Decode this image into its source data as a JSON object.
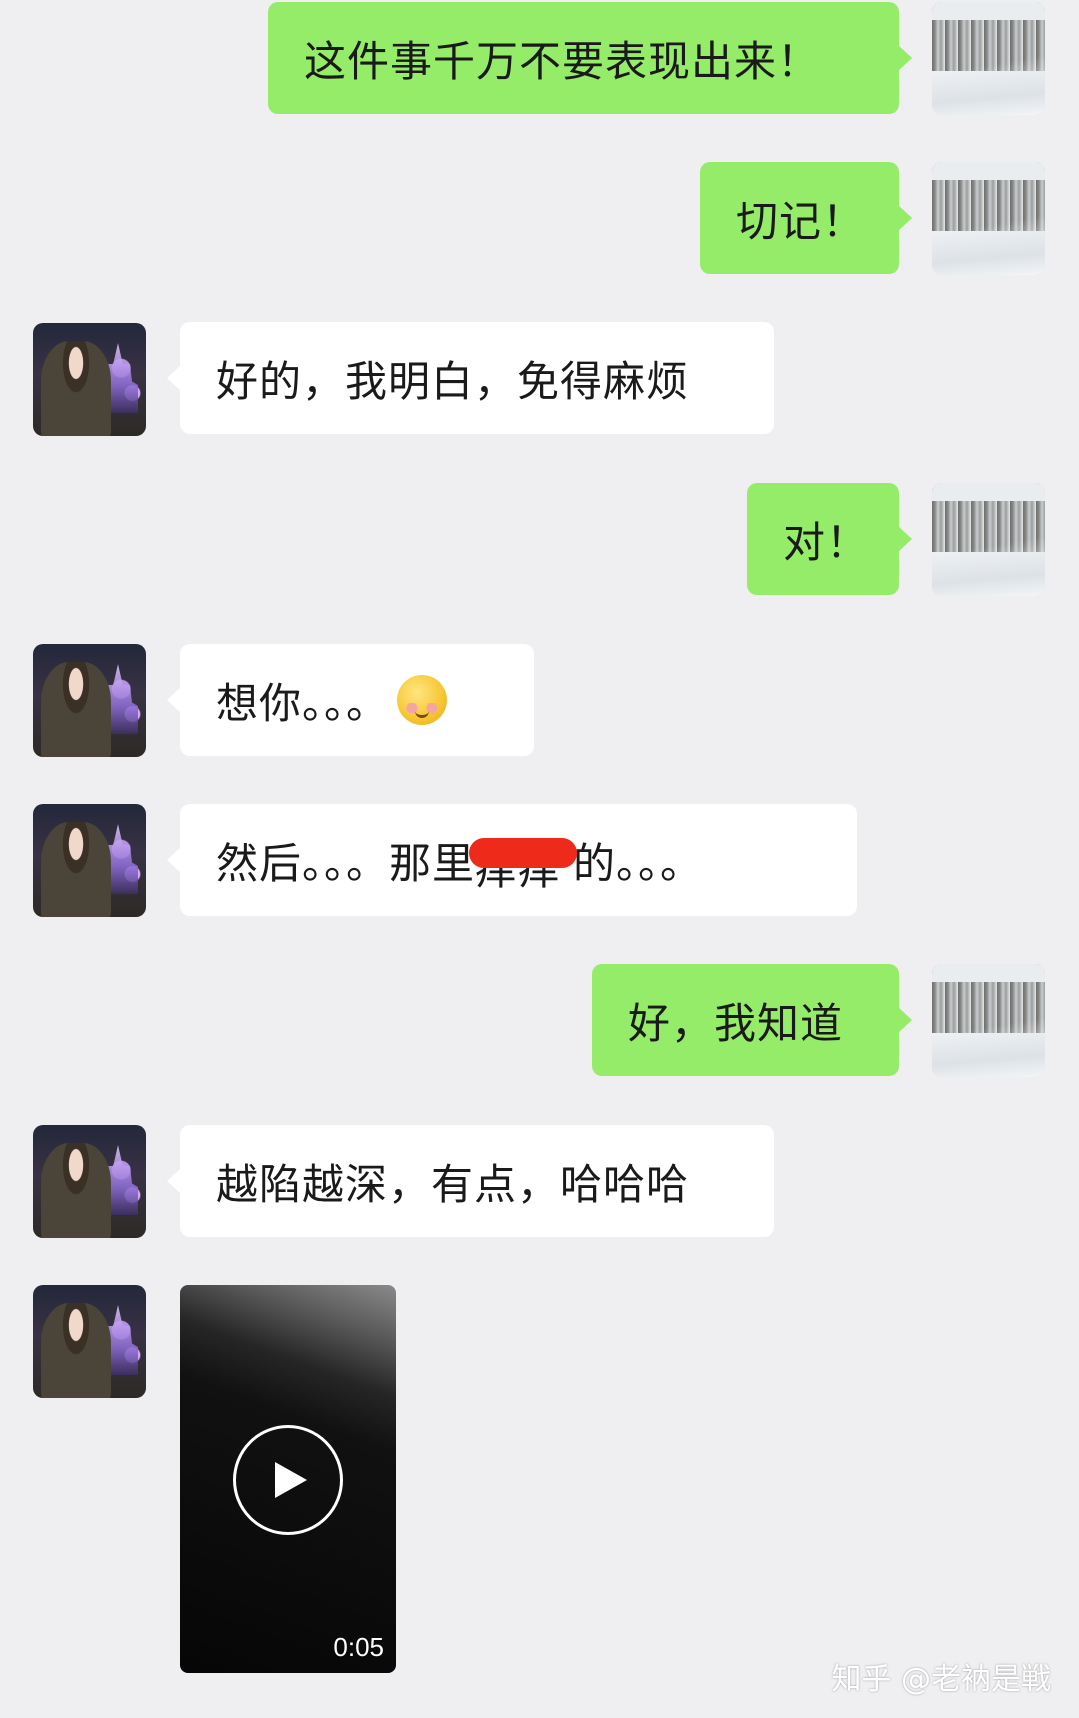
{
  "messages": [
    {
      "sender": "me",
      "text": "这件事千万不要表现出来！"
    },
    {
      "sender": "me",
      "text": "切记！"
    },
    {
      "sender": "them",
      "text": "好的，我明白，免得麻烦"
    },
    {
      "sender": "me",
      "text": "对！"
    },
    {
      "sender": "them",
      "text": "想你。。。",
      "emoji": "blushing-smiley"
    },
    {
      "sender": "them",
      "text_before": "然后。。。那里",
      "redacted": "痒痒",
      "text_after": "的。。。"
    },
    {
      "sender": "me",
      "text": "好，我知道"
    },
    {
      "sender": "them",
      "text": "越陷越深，有点，哈哈哈"
    },
    {
      "sender": "them",
      "type": "video",
      "duration": "0:05"
    }
  ],
  "watermark": {
    "text": "知乎 @老衲是戦"
  },
  "colors": {
    "outgoing_bubble": "#95ec69",
    "incoming_bubble": "#ffffff",
    "background": "#efeff1"
  }
}
